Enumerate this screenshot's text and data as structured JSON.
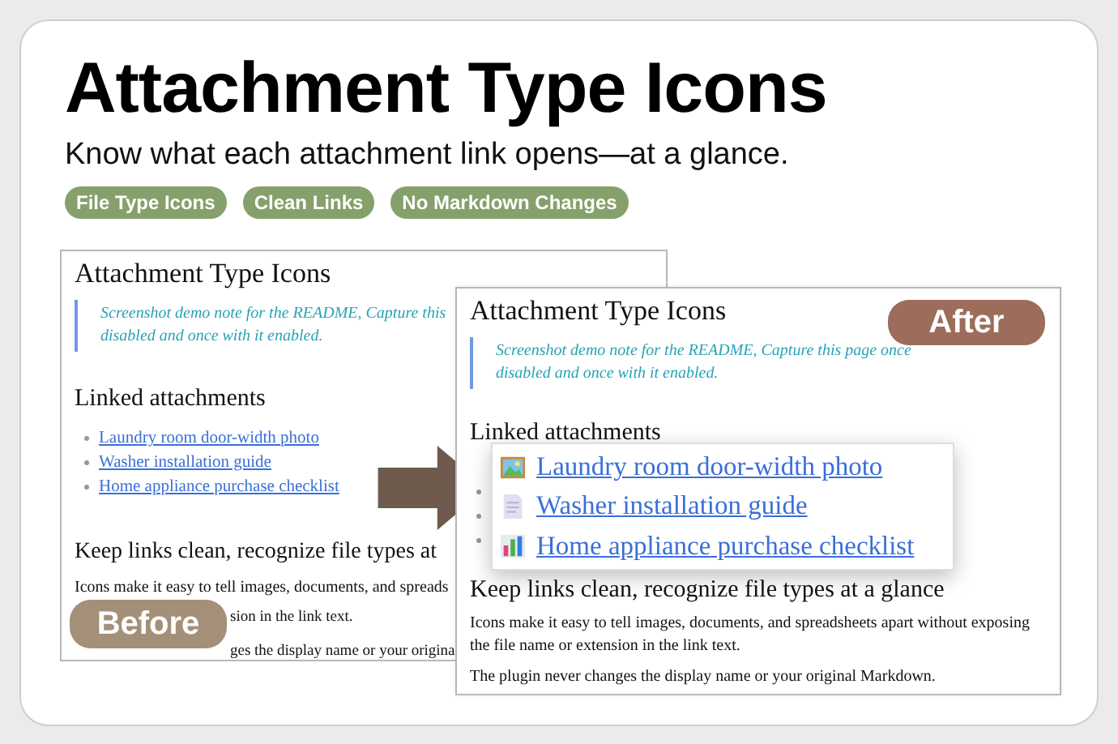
{
  "header": {
    "title": "Attachment Type Icons",
    "subtitle": "Know what each attachment link opens—at a glance.",
    "tags": [
      "File Type Icons",
      "Clean Links",
      "No Markdown Changes"
    ]
  },
  "before": {
    "badge": "Before",
    "title": "Attachment Type Icons",
    "note": [
      "Screenshot demo note for the README, Capture this",
      "disabled and once with it enabled."
    ],
    "section": "Linked attachments",
    "links": [
      "Laundry room door-width photo",
      "Washer installation guide",
      "Home appliance purchase checklist"
    ],
    "heading": "Keep links clean, recognize file types at",
    "lines": [
      "Icons make it easy to tell images, documents, and spreads",
      "sion in the link text.",
      "ges the display name or your origina"
    ]
  },
  "after": {
    "badge": "After",
    "title": "Attachment Type Icons",
    "note": [
      "Screenshot demo note for the README, Capture this page once",
      "disabled and once with it enabled."
    ],
    "section": "Linked attachments",
    "links": [
      {
        "label": "Laundry room door-width photo",
        "kind": "image"
      },
      {
        "label": "Washer installation guide",
        "kind": "document"
      },
      {
        "label": "Home appliance purchase checklist",
        "kind": "spreadsheet"
      }
    ],
    "heading": "Keep links clean, recognize file types at a glance",
    "paragraphs": [
      "Icons make it easy to tell images, documents, and spreadsheets apart without exposing the file name or extension in the link text.",
      "The plugin never changes the display name or your original Markdown."
    ]
  }
}
